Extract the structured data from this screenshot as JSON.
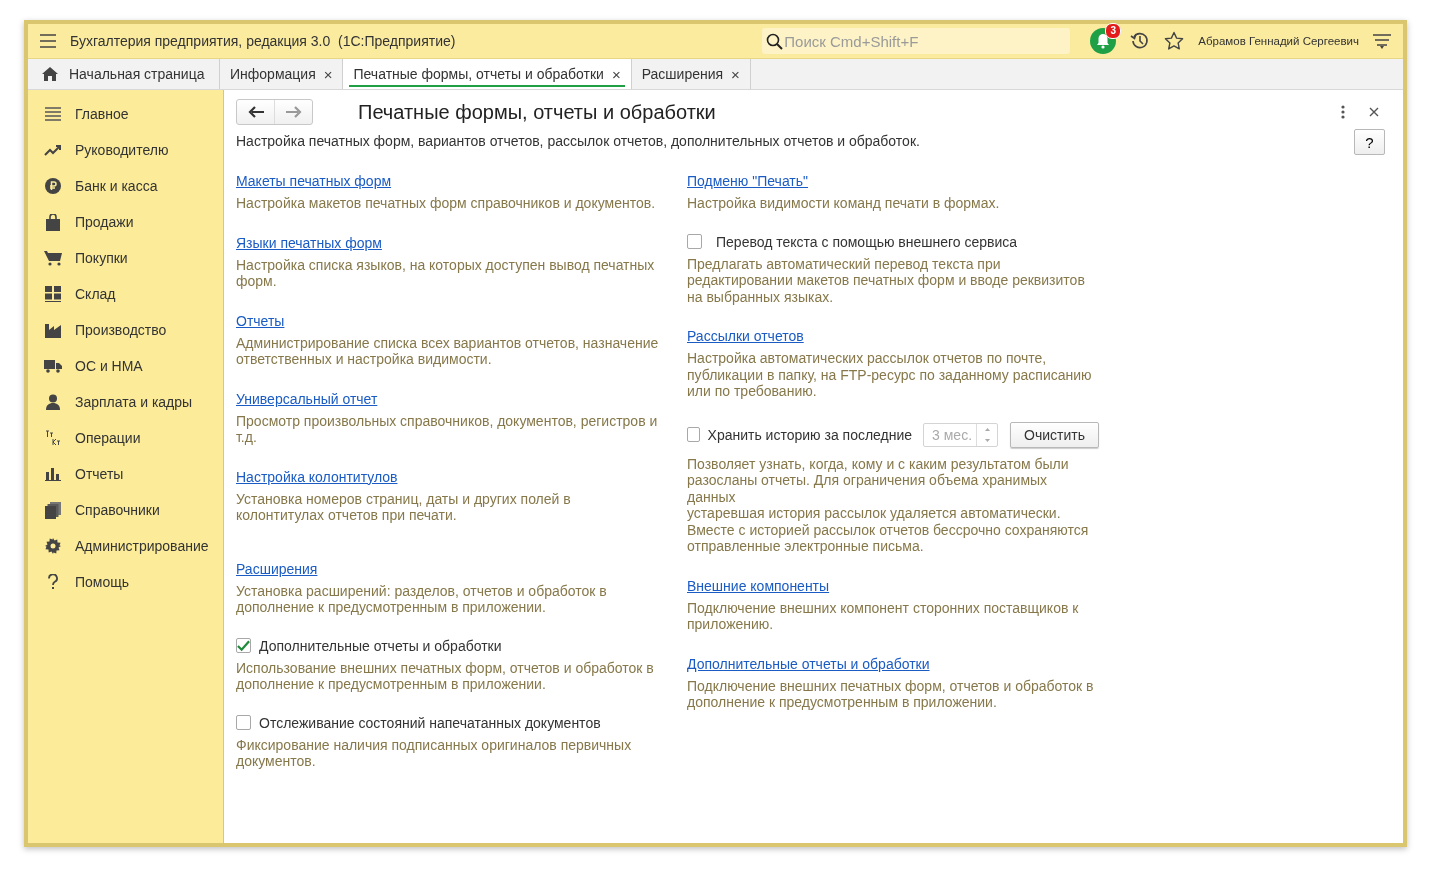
{
  "app": {
    "title": "Бухгалтерия предприятия, редакция 3.0  (1С:Предприятие)",
    "search_placeholder": "Поиск Cmd+Shift+F",
    "notifications": "3",
    "user": "Абрамов Геннадий Сергеевич"
  },
  "tabs": [
    {
      "kind": "home",
      "label": "Начальная страница",
      "selected": false
    },
    {
      "kind": "doc",
      "label": "Информация",
      "selected": false,
      "close": "×"
    },
    {
      "kind": "doc",
      "label": "Печатные формы, отчеты и обработки",
      "selected": true,
      "close": "×"
    },
    {
      "kind": "doc",
      "label": "Расширения",
      "selected": false,
      "close": "×"
    }
  ],
  "sidebar": {
    "items": [
      {
        "label": "Главное"
      },
      {
        "label": "Руководителю"
      },
      {
        "label": "Банк и касса"
      },
      {
        "label": "Продажи"
      },
      {
        "label": "Покупки"
      },
      {
        "label": "Склад"
      },
      {
        "label": "Производство"
      },
      {
        "label": "ОС и НМА"
      },
      {
        "label": "Зарплата и кадры"
      },
      {
        "label": "Операции"
      },
      {
        "label": "Отчеты"
      },
      {
        "label": "Справочники"
      },
      {
        "label": "Администрирование"
      },
      {
        "label": "Помощь"
      }
    ]
  },
  "page": {
    "title": "Печатные формы, отчеты и обработки",
    "help": "?",
    "description": "Настройка печатных форм, вариантов отчетов, рассылок отчетов, дополнительных отчетов и обработок.",
    "left": [
      {
        "kind": "link",
        "title": "Макеты печатных форм",
        "description": "Настройка макетов печатных форм справочников и документов."
      },
      {
        "kind": "link",
        "title": "Языки печатных форм",
        "description": "Настройка списка языков, на которых доступен вывод печатных форм."
      },
      {
        "kind": "link",
        "title": "Отчеты",
        "description": "Администрирование списка всех вариантов отчетов, назначение ответственных и настройка видимости."
      },
      {
        "kind": "link",
        "title": "Универсальный отчет",
        "description": "Просмотр произвольных справочников, документов, регистров и т.д."
      },
      {
        "kind": "link",
        "title": "Настройка колонтитулов",
        "description": "Установка номеров страниц, даты и других полей в колонтитулах отчетов при печати."
      },
      {
        "kind": "link",
        "title": "Расширения",
        "description": "Установка расширений: разделов, отчетов и обработок в дополнение к предусмотренным в приложении."
      },
      {
        "kind": "checkbox",
        "title": "Дополнительные отчеты и обработки",
        "checked": true,
        "description": "Использование внешних печатных форм, отчетов и обработок в дополнение к предусмотренным в приложении."
      },
      {
        "kind": "checkbox",
        "title": "Отслеживание состояний напечатанных документов",
        "checked": false,
        "description": "Фиксирование наличия подписанных оригиналов первичных документов."
      }
    ],
    "right": [
      {
        "kind": "link",
        "title": "Подменю \"Печать\"",
        "description": "Настройка видимости команд печати в формах."
      },
      {
        "kind": "checkbox",
        "title": "Перевод текста с помощью внешнего сервиса",
        "checked": false,
        "description": "Предлагать автоматический перевод текста при редактировании макетов печатных форм и вводе реквизитов на выбранных языках."
      },
      {
        "kind": "link",
        "title": "Рассылки отчетов",
        "description": "Настройка автоматических рассылок отчетов по почте, публикации в папку, на FTP-ресурс по заданному расписанию или по требованию."
      },
      {
        "kind": "history",
        "title": "Хранить историю за последние",
        "checked": false,
        "value": "3 мес.",
        "disabled": true,
        "button": "Очистить",
        "description": "Позволяет узнать, когда, кому и с каким результатом были разосланы отчеты. Для ограничения объема хранимых данных\nустаревшая история рассылок удаляется автоматически. Вместе с историей рассылок отчетов бессрочно сохраняются отправленные электронные письма."
      },
      {
        "kind": "link",
        "title": "Внешние компоненты",
        "description": "Подключение внешних компонент сторонних поставщиков к приложению."
      },
      {
        "kind": "link",
        "title": "Дополнительные отчеты и обработки",
        "description": "Подключение внешних печатных форм, отчетов и обработок в дополнение к предусмотренным в приложении."
      }
    ]
  }
}
